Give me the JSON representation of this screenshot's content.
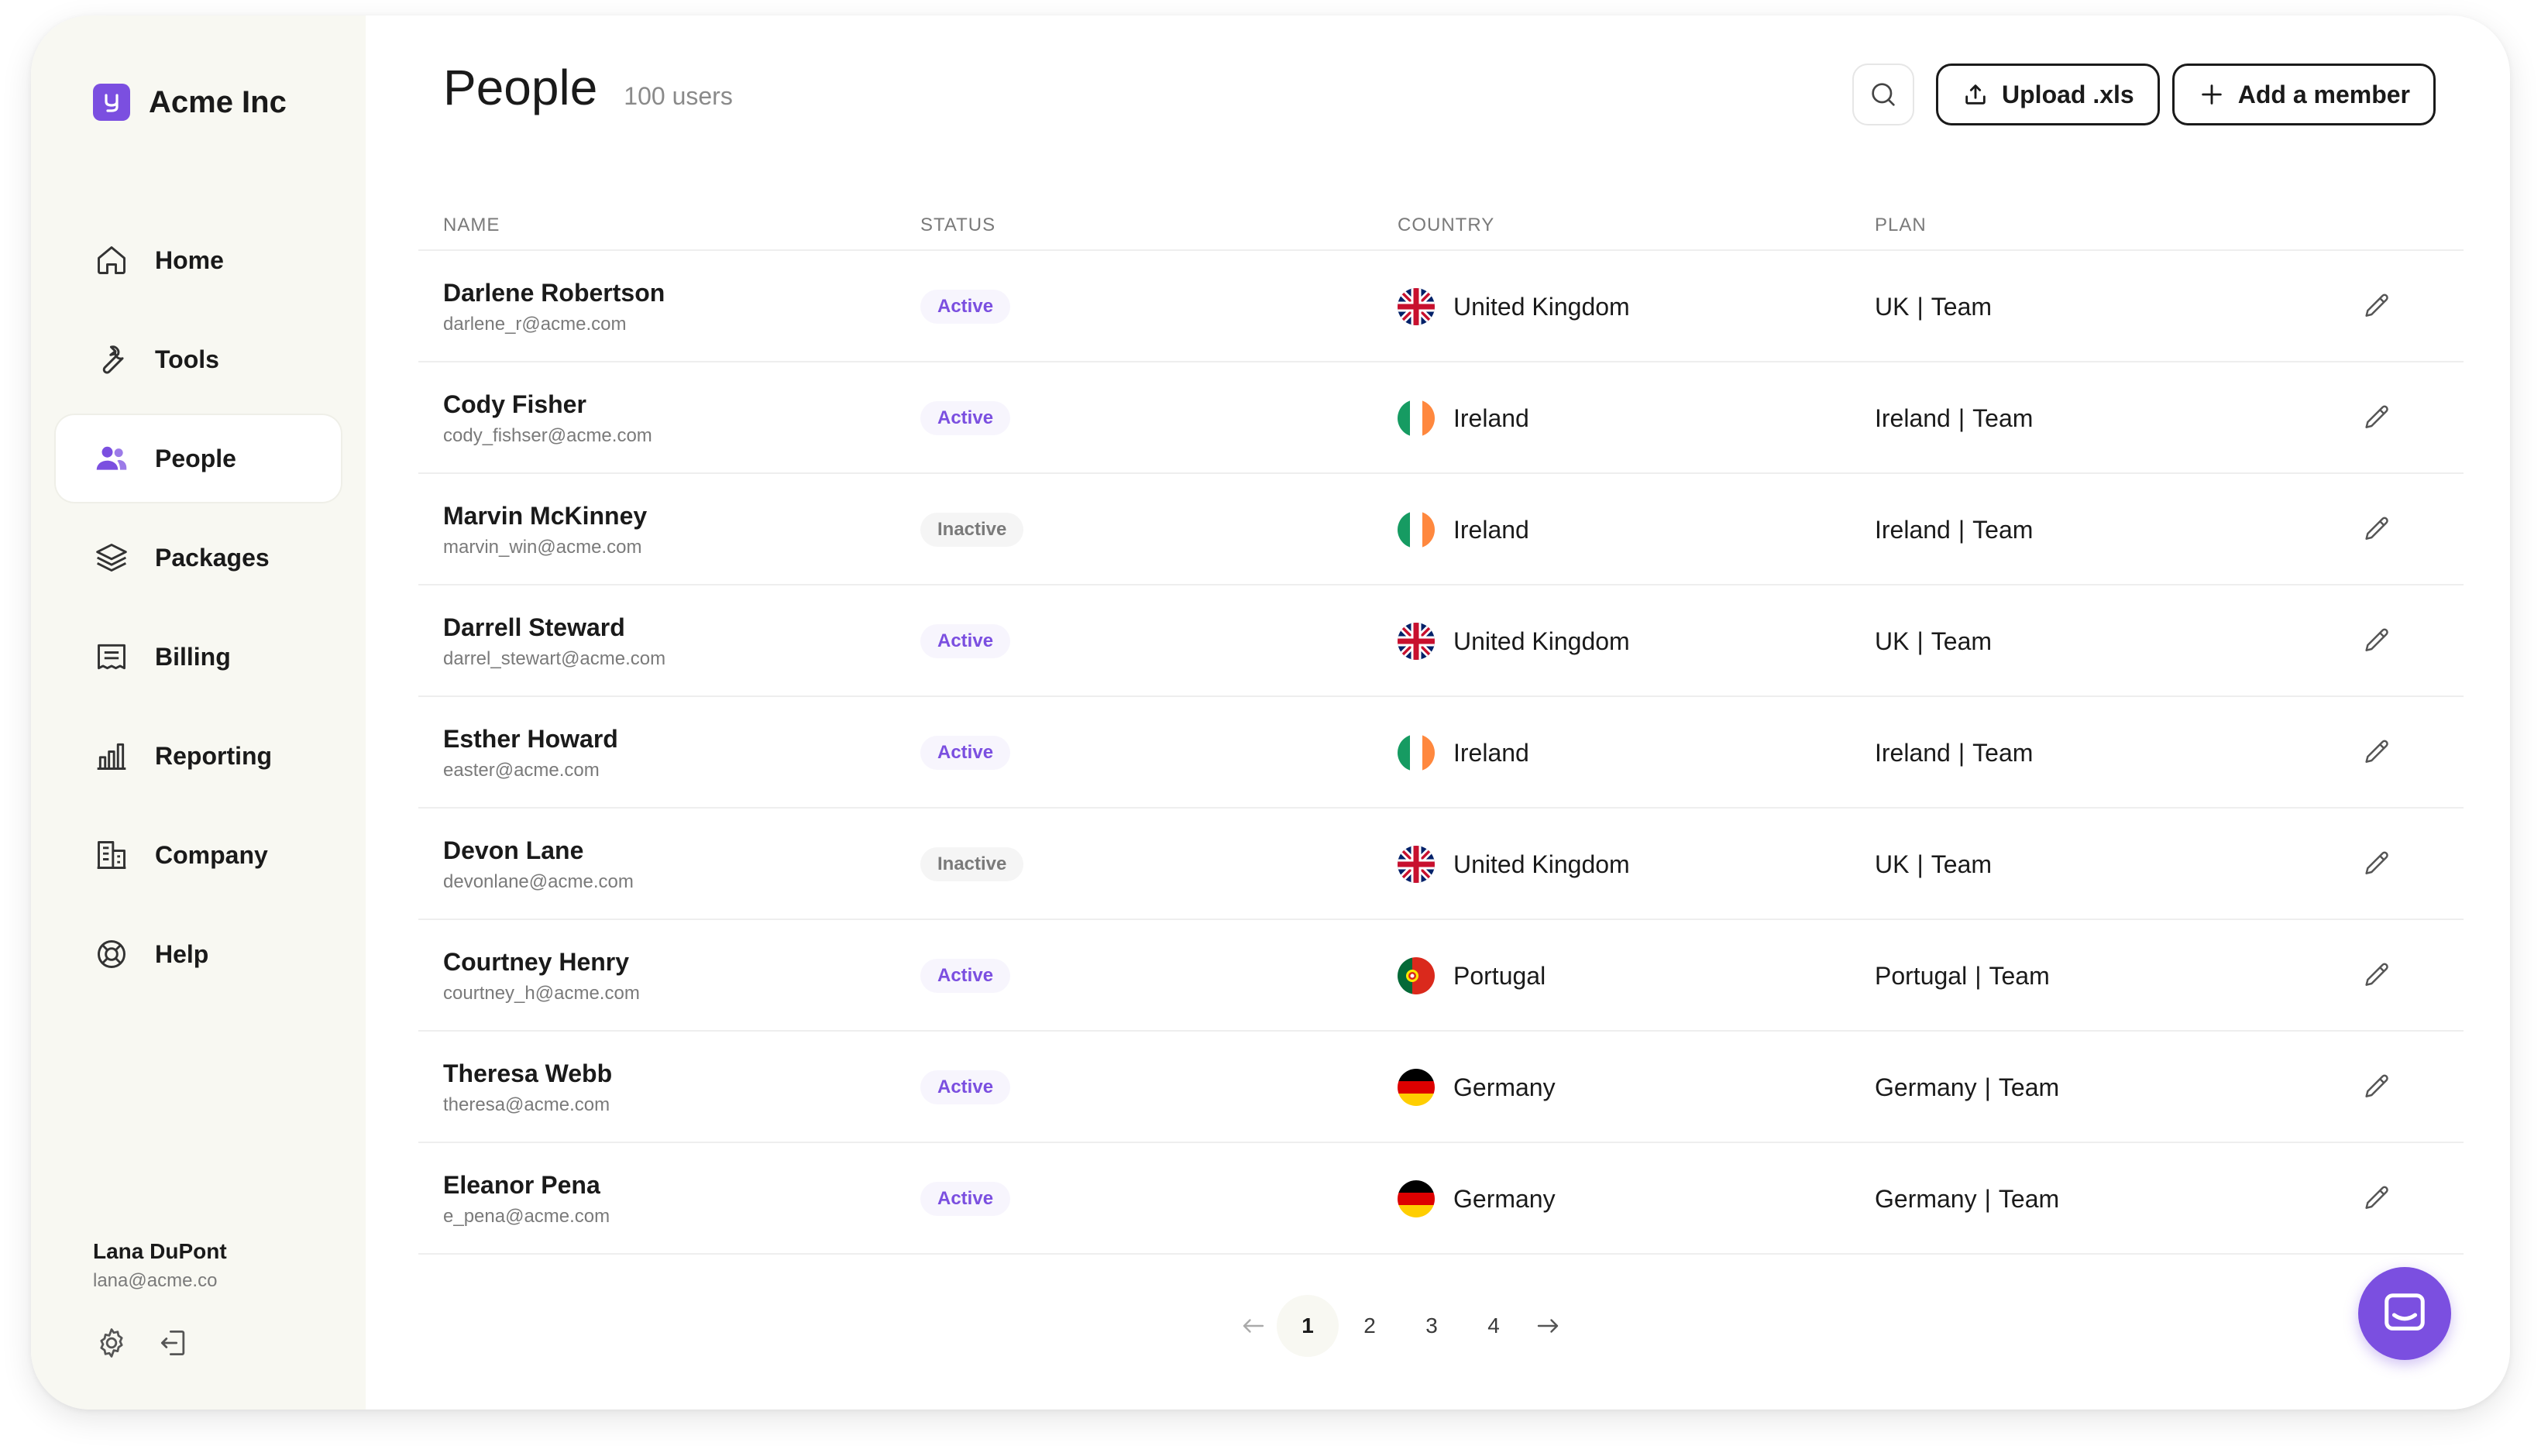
{
  "brand": {
    "name": "Acme Inc",
    "logo_glyph": "y",
    "accent": "#7b4fe0"
  },
  "sidebar": {
    "items": [
      {
        "label": "Home",
        "icon": "home-icon",
        "active": false
      },
      {
        "label": "Tools",
        "icon": "wrench-icon",
        "active": false
      },
      {
        "label": "People",
        "icon": "users-icon",
        "active": true
      },
      {
        "label": "Packages",
        "icon": "layers-icon",
        "active": false
      },
      {
        "label": "Billing",
        "icon": "receipt-icon",
        "active": false
      },
      {
        "label": "Reporting",
        "icon": "bar-chart-icon",
        "active": false
      },
      {
        "label": "Company",
        "icon": "building-icon",
        "active": false
      },
      {
        "label": "Help",
        "icon": "lifebuoy-icon",
        "active": false
      }
    ],
    "user": {
      "name": "Lana DuPont",
      "email": "lana@acme.co"
    }
  },
  "header": {
    "title": "People",
    "count": "100 users",
    "upload_label": "Upload .xls",
    "add_label": "Add a member"
  },
  "table": {
    "columns": {
      "name": "NAME",
      "status": "STATUS",
      "country": "COUNTRY",
      "plan": "PLAN"
    },
    "rows": [
      {
        "name": "Darlene Robertson",
        "email": "darlene_r@acme.com",
        "status": "Active",
        "country": "United Kingdom",
        "flag": "uk",
        "plan_country": "UK",
        "plan_sep": "|",
        "plan_tier": "Team"
      },
      {
        "name": "Cody Fisher",
        "email": "cody_fishser@acme.com",
        "status": "Active",
        "country": "Ireland",
        "flag": "ie",
        "plan_country": "Ireland",
        "plan_sep": "|",
        "plan_tier": "Team"
      },
      {
        "name": "Marvin McKinney",
        "email": "marvin_win@acme.com",
        "status": "Inactive",
        "country": "Ireland",
        "flag": "ie",
        "plan_country": "Ireland",
        "plan_sep": "|",
        "plan_tier": "Team"
      },
      {
        "name": "Darrell Steward",
        "email": "darrel_stewart@acme.com",
        "status": "Active",
        "country": "United Kingdom",
        "flag": "uk",
        "plan_country": "UK",
        "plan_sep": "|",
        "plan_tier": "Team"
      },
      {
        "name": "Esther Howard",
        "email": "easter@acme.com",
        "status": "Active",
        "country": "Ireland",
        "flag": "ie",
        "plan_country": "Ireland",
        "plan_sep": "|",
        "plan_tier": "Team"
      },
      {
        "name": "Devon Lane",
        "email": "devonlane@acme.com",
        "status": "Inactive",
        "country": "United Kingdom",
        "flag": "uk",
        "plan_country": "UK",
        "plan_sep": "|",
        "plan_tier": "Team"
      },
      {
        "name": "Courtney Henry",
        "email": "courtney_h@acme.com",
        "status": "Active",
        "country": "Portugal",
        "flag": "pt",
        "plan_country": "Portugal",
        "plan_sep": "|",
        "plan_tier": "Team"
      },
      {
        "name": "Theresa Webb",
        "email": "theresa@acme.com",
        "status": "Active",
        "country": "Germany",
        "flag": "de",
        "plan_country": "Germany",
        "plan_sep": "|",
        "plan_tier": "Team"
      },
      {
        "name": "Eleanor Pena",
        "email": "e_pena@acme.com",
        "status": "Active",
        "country": "Germany",
        "flag": "de",
        "plan_country": "Germany",
        "plan_sep": "|",
        "plan_tier": "Team"
      }
    ]
  },
  "pagination": {
    "pages": [
      "1",
      "2",
      "3",
      "4"
    ],
    "current": "1"
  },
  "colors": {
    "sidebar_bg": "#f8f8f2",
    "active_badge_text": "#7b4fe0",
    "inactive_badge_text": "#7a7a7a"
  }
}
